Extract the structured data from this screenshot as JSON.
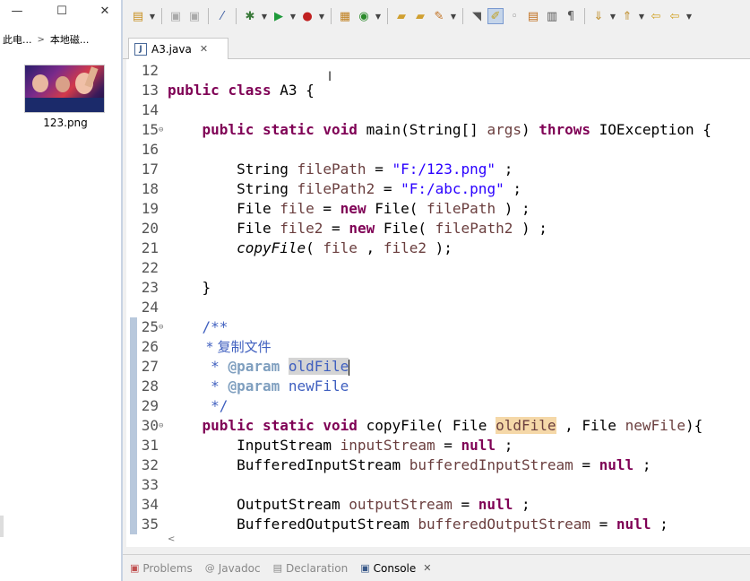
{
  "explorer": {
    "window_controls": {
      "minimize": "—",
      "maximize": "☐",
      "close": "✕"
    },
    "breadcrumb": [
      "此电...",
      "本地磁..."
    ],
    "file": {
      "name": "123.png"
    }
  },
  "toolbar": {
    "icons": [
      "new-icon",
      "save-icon",
      "save-all-icon",
      "skip-breakpoints-icon",
      "debug-icon",
      "run-icon",
      "run-external-icon",
      "new-java-package-icon",
      "new-class-icon",
      "open-type-icon",
      "open-task-icon",
      "search-icon",
      "next-annotation-icon",
      "highlight-icon",
      "pin-icon",
      "toggle-mark-icon",
      "show-whitespace-icon",
      "paragraph-icon",
      "next-edit-icon",
      "prev-edit-icon",
      "back-icon",
      "forward-icon"
    ]
  },
  "editor_tab": {
    "label": "A3.java",
    "icon": "J"
  },
  "code": {
    "lines": [
      {
        "n": "12"
      },
      {
        "n": "13"
      },
      {
        "n": "14"
      },
      {
        "n": "15"
      },
      {
        "n": "16"
      },
      {
        "n": "17"
      },
      {
        "n": "18"
      },
      {
        "n": "19"
      },
      {
        "n": "20"
      },
      {
        "n": "21"
      },
      {
        "n": "22"
      },
      {
        "n": "23"
      },
      {
        "n": "24"
      },
      {
        "n": "25"
      },
      {
        "n": "26"
      },
      {
        "n": "27"
      },
      {
        "n": "28"
      },
      {
        "n": "29"
      },
      {
        "n": "30"
      },
      {
        "n": "31"
      },
      {
        "n": "32"
      },
      {
        "n": "33"
      },
      {
        "n": "34"
      },
      {
        "n": "35"
      }
    ],
    "t": {
      "public": "public",
      "class": "class",
      "static": "static",
      "void": "void",
      "throws": "throws",
      "new": "new",
      "null": "null",
      "A3": " A3 {",
      "main": " main(String[] ",
      "args": "args",
      "main_tail": ") ",
      "ioex": " IOException {",
      "String": "String ",
      "filePath": "filePath",
      "filePath2": "filePath2",
      "eq": " = ",
      "s1": "\"F:/123.png\"",
      "s2": "\"F:/abc.png\"",
      "semi": " ;",
      "File": "File ",
      "file": "file",
      "file2": "file2",
      "File_open": " File( ",
      "close_semi": " ) ;",
      "copyFile": "copyFile",
      "cf_open": "( ",
      "comma": " , ",
      "cf_close": " );",
      "rbrace": "}",
      "jd_open": "/**",
      "jd_desc": " * 复制文件",
      "jd_star": " * ",
      "param": "@param",
      "sp": " ",
      "oldFile": "oldFile",
      "newFile": "newFile",
      "jd_close": " */",
      "copyFile_decl": " copyFile( File ",
      "cf_sig_tail": " , File ",
      "newFile_tail": "){",
      "InputStream": "InputStream ",
      "inputStream": "inputStream",
      "BIS": "BufferedInputStream ",
      "bufferedInputStream": "bufferedInputStream",
      "OutputStream": "OutputStream ",
      "outputStream": "outputStream",
      "BOS": "BufferedOutputStream ",
      "bufferedOutputStream": "bufferedOutputStream"
    }
  },
  "bottom_tabs": [
    {
      "label": "Problems"
    },
    {
      "label": "Javadoc"
    },
    {
      "label": "Declaration"
    },
    {
      "label": "Console",
      "close": "✕"
    }
  ],
  "hscroll": "<",
  "colors": {
    "keyword": "#7f0055",
    "string": "#2a00ff",
    "javadoc": "#3f5fbf",
    "local_var": "#6a3e3e",
    "selection_orange": "#f5d8a8"
  }
}
